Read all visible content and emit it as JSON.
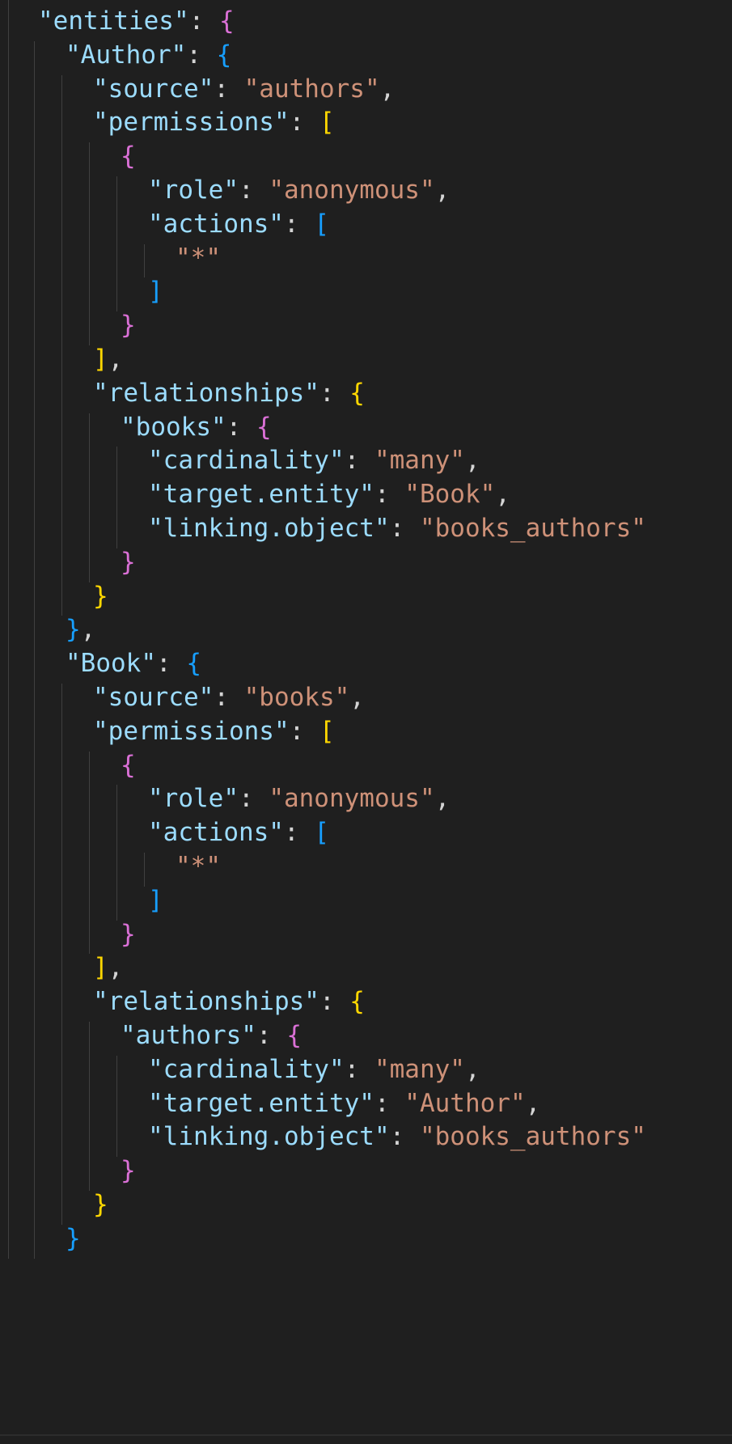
{
  "editor": {
    "language": "json",
    "theme_colors": {
      "background": "#1f1f1f",
      "key": "#9cdcfe",
      "string": "#ce9178",
      "punctuation": "#d4d4d4",
      "bracket_level_1": "#ffd700",
      "bracket_level_2": "#da70d6",
      "bracket_level_3": "#179fff",
      "indent_guide": "#404040"
    },
    "lines": [
      {
        "indent": 0,
        "tokens": [
          {
            "t": "\"entities\"",
            "c": "key"
          },
          {
            "t": ": ",
            "c": "punc"
          },
          {
            "t": "{",
            "c": "b2"
          }
        ]
      },
      {
        "indent": 1,
        "tokens": [
          {
            "t": "\"Author\"",
            "c": "key"
          },
          {
            "t": ": ",
            "c": "punc"
          },
          {
            "t": "{",
            "c": "b3"
          }
        ]
      },
      {
        "indent": 2,
        "tokens": [
          {
            "t": "\"source\"",
            "c": "key"
          },
          {
            "t": ": ",
            "c": "punc"
          },
          {
            "t": "\"authors\"",
            "c": "str"
          },
          {
            "t": ",",
            "c": "punc"
          }
        ]
      },
      {
        "indent": 2,
        "tokens": [
          {
            "t": "\"permissions\"",
            "c": "key"
          },
          {
            "t": ": ",
            "c": "punc"
          },
          {
            "t": "[",
            "c": "b1"
          }
        ]
      },
      {
        "indent": 3,
        "tokens": [
          {
            "t": "{",
            "c": "b2"
          }
        ]
      },
      {
        "indent": 4,
        "tokens": [
          {
            "t": "\"role\"",
            "c": "key"
          },
          {
            "t": ": ",
            "c": "punc"
          },
          {
            "t": "\"anonymous\"",
            "c": "str"
          },
          {
            "t": ",",
            "c": "punc"
          }
        ]
      },
      {
        "indent": 4,
        "tokens": [
          {
            "t": "\"actions\"",
            "c": "key"
          },
          {
            "t": ": ",
            "c": "punc"
          },
          {
            "t": "[",
            "c": "b3"
          }
        ]
      },
      {
        "indent": 5,
        "tokens": [
          {
            "t": "\"*\"",
            "c": "str"
          }
        ]
      },
      {
        "indent": 4,
        "tokens": [
          {
            "t": "]",
            "c": "b3"
          }
        ]
      },
      {
        "indent": 3,
        "tokens": [
          {
            "t": "}",
            "c": "b2"
          }
        ]
      },
      {
        "indent": 2,
        "tokens": [
          {
            "t": "]",
            "c": "b1"
          },
          {
            "t": ",",
            "c": "punc"
          }
        ]
      },
      {
        "indent": 2,
        "tokens": [
          {
            "t": "\"relationships\"",
            "c": "key"
          },
          {
            "t": ": ",
            "c": "punc"
          },
          {
            "t": "{",
            "c": "b1"
          }
        ]
      },
      {
        "indent": 3,
        "tokens": [
          {
            "t": "\"books\"",
            "c": "key"
          },
          {
            "t": ": ",
            "c": "punc"
          },
          {
            "t": "{",
            "c": "b2"
          }
        ]
      },
      {
        "indent": 4,
        "tokens": [
          {
            "t": "\"cardinality\"",
            "c": "key"
          },
          {
            "t": ": ",
            "c": "punc"
          },
          {
            "t": "\"many\"",
            "c": "str"
          },
          {
            "t": ",",
            "c": "punc"
          }
        ]
      },
      {
        "indent": 4,
        "tokens": [
          {
            "t": "\"target.entity\"",
            "c": "key"
          },
          {
            "t": ": ",
            "c": "punc"
          },
          {
            "t": "\"Book\"",
            "c": "str"
          },
          {
            "t": ",",
            "c": "punc"
          }
        ]
      },
      {
        "indent": 4,
        "tokens": [
          {
            "t": "\"linking.object\"",
            "c": "key"
          },
          {
            "t": ": ",
            "c": "punc"
          },
          {
            "t": "\"books_authors\"",
            "c": "str"
          }
        ]
      },
      {
        "indent": 3,
        "tokens": [
          {
            "t": "}",
            "c": "b2"
          }
        ]
      },
      {
        "indent": 2,
        "tokens": [
          {
            "t": "}",
            "c": "b1"
          }
        ]
      },
      {
        "indent": 1,
        "tokens": [
          {
            "t": "}",
            "c": "b3"
          },
          {
            "t": ",",
            "c": "punc"
          }
        ]
      },
      {
        "indent": 1,
        "tokens": [
          {
            "t": "\"Book\"",
            "c": "key"
          },
          {
            "t": ": ",
            "c": "punc"
          },
          {
            "t": "{",
            "c": "b3"
          }
        ]
      },
      {
        "indent": 2,
        "tokens": [
          {
            "t": "\"source\"",
            "c": "key"
          },
          {
            "t": ": ",
            "c": "punc"
          },
          {
            "t": "\"books\"",
            "c": "str"
          },
          {
            "t": ",",
            "c": "punc"
          }
        ]
      },
      {
        "indent": 2,
        "tokens": [
          {
            "t": "\"permissions\"",
            "c": "key"
          },
          {
            "t": ": ",
            "c": "punc"
          },
          {
            "t": "[",
            "c": "b1"
          }
        ]
      },
      {
        "indent": 3,
        "tokens": [
          {
            "t": "{",
            "c": "b2"
          }
        ]
      },
      {
        "indent": 4,
        "tokens": [
          {
            "t": "\"role\"",
            "c": "key"
          },
          {
            "t": ": ",
            "c": "punc"
          },
          {
            "t": "\"anonymous\"",
            "c": "str"
          },
          {
            "t": ",",
            "c": "punc"
          }
        ]
      },
      {
        "indent": 4,
        "tokens": [
          {
            "t": "\"actions\"",
            "c": "key"
          },
          {
            "t": ": ",
            "c": "punc"
          },
          {
            "t": "[",
            "c": "b3"
          }
        ]
      },
      {
        "indent": 5,
        "tokens": [
          {
            "t": "\"*\"",
            "c": "str"
          }
        ]
      },
      {
        "indent": 4,
        "tokens": [
          {
            "t": "]",
            "c": "b3"
          }
        ]
      },
      {
        "indent": 3,
        "tokens": [
          {
            "t": "}",
            "c": "b2"
          }
        ]
      },
      {
        "indent": 2,
        "tokens": [
          {
            "t": "]",
            "c": "b1"
          },
          {
            "t": ",",
            "c": "punc"
          }
        ]
      },
      {
        "indent": 2,
        "tokens": [
          {
            "t": "\"relationships\"",
            "c": "key"
          },
          {
            "t": ": ",
            "c": "punc"
          },
          {
            "t": "{",
            "c": "b1"
          }
        ]
      },
      {
        "indent": 3,
        "tokens": [
          {
            "t": "\"authors\"",
            "c": "key"
          },
          {
            "t": ": ",
            "c": "punc"
          },
          {
            "t": "{",
            "c": "b2"
          }
        ]
      },
      {
        "indent": 4,
        "tokens": [
          {
            "t": "\"cardinality\"",
            "c": "key"
          },
          {
            "t": ": ",
            "c": "punc"
          },
          {
            "t": "\"many\"",
            "c": "str"
          },
          {
            "t": ",",
            "c": "punc"
          }
        ]
      },
      {
        "indent": 4,
        "tokens": [
          {
            "t": "\"target.entity\"",
            "c": "key"
          },
          {
            "t": ": ",
            "c": "punc"
          },
          {
            "t": "\"Author\"",
            "c": "str"
          },
          {
            "t": ",",
            "c": "punc"
          }
        ]
      },
      {
        "indent": 4,
        "tokens": [
          {
            "t": "\"linking.object\"",
            "c": "key"
          },
          {
            "t": ": ",
            "c": "punc"
          },
          {
            "t": "\"books_authors\"",
            "c": "str"
          }
        ]
      },
      {
        "indent": 3,
        "tokens": [
          {
            "t": "}",
            "c": "b2"
          }
        ]
      },
      {
        "indent": 2,
        "tokens": [
          {
            "t": "}",
            "c": "b1"
          }
        ]
      },
      {
        "indent": 1,
        "tokens": [
          {
            "t": "}",
            "c": "b3"
          }
        ]
      }
    ]
  }
}
